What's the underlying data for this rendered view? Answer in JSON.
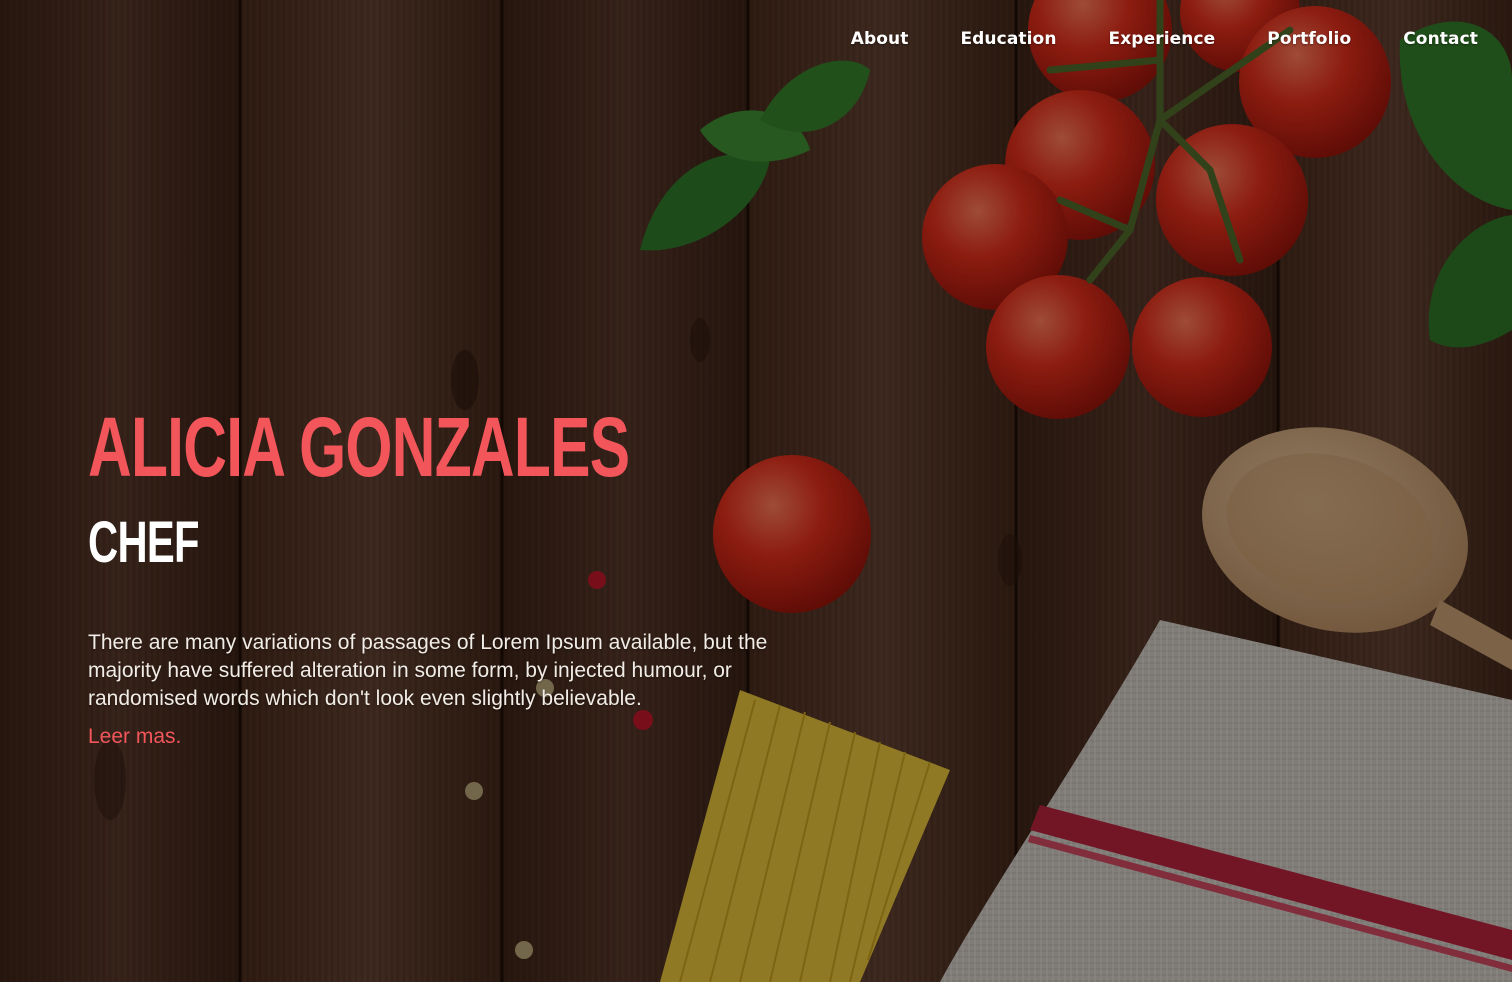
{
  "nav": {
    "items": [
      {
        "label": "About"
      },
      {
        "label": "Education"
      },
      {
        "label": "Experience"
      },
      {
        "label": "Portfolio"
      },
      {
        "label": "Contact"
      }
    ]
  },
  "hero": {
    "name": "ALICIA GONZALES",
    "role": "CHEF",
    "description": "There are many variations of passages of Lorem Ipsum available, but the majority have suffered alteration in some form, by injected humour, or randomised words which don't look even slightly believable.",
    "link_label": "Leer mas."
  },
  "colors": {
    "accent": "#f2565b",
    "text": "#ffffff",
    "wood": "#4a2e1f"
  },
  "background": {
    "icons": [
      "wood-planks",
      "tomato-icon",
      "basil-leaf-icon",
      "wooden-spoon-icon",
      "spaghetti-icon",
      "kitchen-towel-icon",
      "peppercorn-icon"
    ]
  }
}
